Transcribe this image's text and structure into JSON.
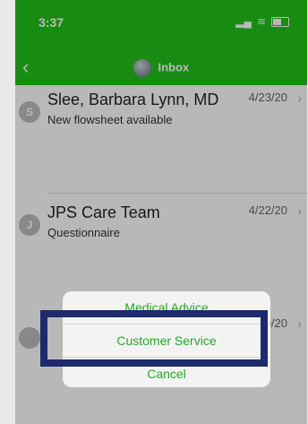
{
  "status": {
    "time": "3:37"
  },
  "nav": {
    "title": "Inbox"
  },
  "messages": [
    {
      "initial": "S",
      "sender": "Slee, Barbara Lynn, MD",
      "subject": "New flowsheet available",
      "date": "4/23/20"
    },
    {
      "initial": "J",
      "sender": "JPS Care Team",
      "subject": "Questionnaire",
      "date": "4/22/20"
    },
    {
      "initial": "",
      "sender": "",
      "subject": "",
      "date": "0/20"
    }
  ],
  "action_sheet": {
    "top_label": "Medical Advice",
    "highlighted_label": "Customer Service",
    "cancel_label": "Cancel"
  },
  "colors": {
    "header": "#22c21a",
    "accent": "#27a624",
    "highlight_border": "#1d2a6b"
  }
}
